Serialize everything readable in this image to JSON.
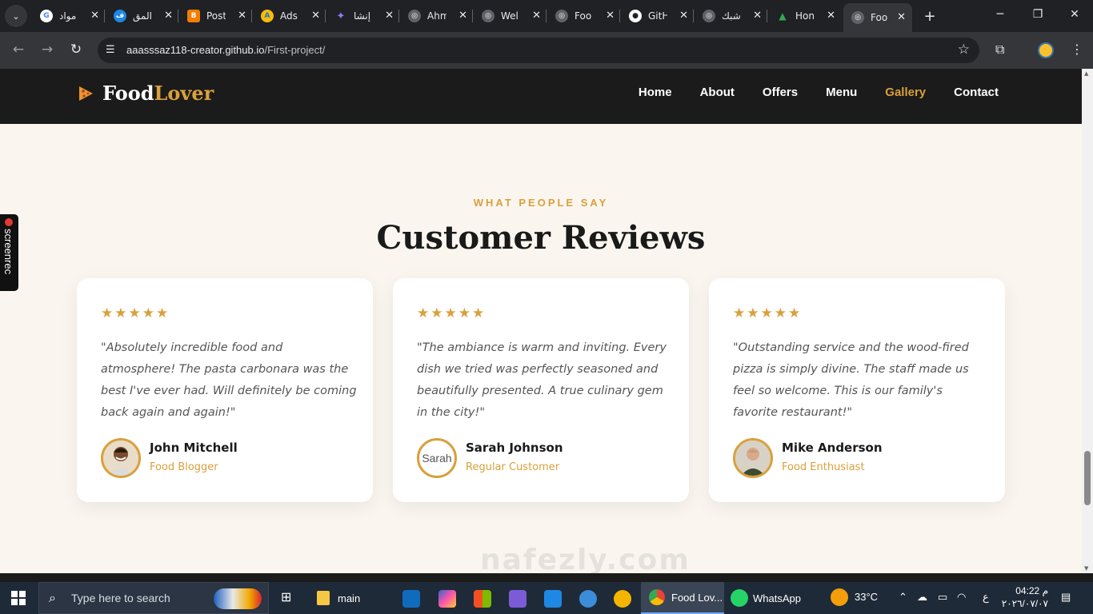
{
  "browser": {
    "tabs": [
      {
        "label": "مواد",
        "favicon_color": "#4285f4",
        "favicon_text": "G"
      },
      {
        "label": "المق",
        "favicon_color": "#1e88e5",
        "favicon_text": "ف"
      },
      {
        "label": "Post",
        "favicon_color": "#f57c00",
        "favicon_text": "B"
      },
      {
        "label": "Ads",
        "favicon_color": "#fbbc04",
        "favicon_text": "A"
      },
      {
        "label": "إنشا",
        "favicon_color": "#7c4dff",
        "favicon_text": "✦"
      },
      {
        "label": "Ahm",
        "favicon_color": "#5f6368",
        "favicon_text": "◎"
      },
      {
        "label": "Wel",
        "favicon_color": "#5f6368",
        "favicon_text": "◎"
      },
      {
        "label": "Foo",
        "favicon_color": "#5f6368",
        "favicon_text": "◎"
      },
      {
        "label": "GitH",
        "favicon_color": "#ffffff",
        "favicon_text": "●"
      },
      {
        "label": "شبك",
        "favicon_color": "#5f6368",
        "favicon_text": "◎"
      },
      {
        "label": "Hon",
        "favicon_color": "#34a853",
        "favicon_text": "▲"
      },
      {
        "label": "Foo",
        "favicon_color": "#5f6368",
        "favicon_text": "◎"
      }
    ],
    "url_host": "aaasssaz118-creator.github.io",
    "url_path": "/First-project/"
  },
  "site": {
    "brand_main": "Food",
    "brand_accent": "Lover",
    "nav": [
      "Home",
      "About",
      "Offers",
      "Menu",
      "Gallery",
      "Contact"
    ],
    "active_nav": "Gallery",
    "accent_color": "#d9a03c"
  },
  "reviews": {
    "eyebrow": "WHAT PEOPLE SAY",
    "title": "Customer Reviews",
    "items": [
      {
        "stars": "★★★★★",
        "quote": "\"Absolutely incredible food and atmosphere! The pasta carbonara was the best I've ever had. Will definitely be coming back again and again!\"",
        "name": "John Mitchell",
        "role": "Food Blogger"
      },
      {
        "stars": "★★★★★",
        "quote": "\"The ambiance is warm and inviting. Every dish we tried was perfectly seasoned and beautifully presented. A true culinary gem in the city!\"",
        "name": "Sarah Johnson",
        "role": "Regular Customer",
        "avatar_alt": "Sarah"
      },
      {
        "stars": "★★★★★",
        "quote": "\"Outstanding service and the wood-fired pizza is simply divine. The staff made us feel so welcome. This is our family's favorite restaurant!\"",
        "name": "Mike Anderson",
        "role": "Food Enthusiast"
      }
    ]
  },
  "overlay": {
    "recorder_label": "screenrec",
    "watermark": "nafezly.com"
  },
  "taskbar": {
    "search_placeholder": "Type here to search",
    "folder_label": "main",
    "chrome_label": "Food Lov...",
    "whatsapp_label": "WhatsApp",
    "weather": "33°C",
    "lang": "ع",
    "time": "04:22 م",
    "date": "٢٠٢٦/٠٧/٠٧"
  }
}
